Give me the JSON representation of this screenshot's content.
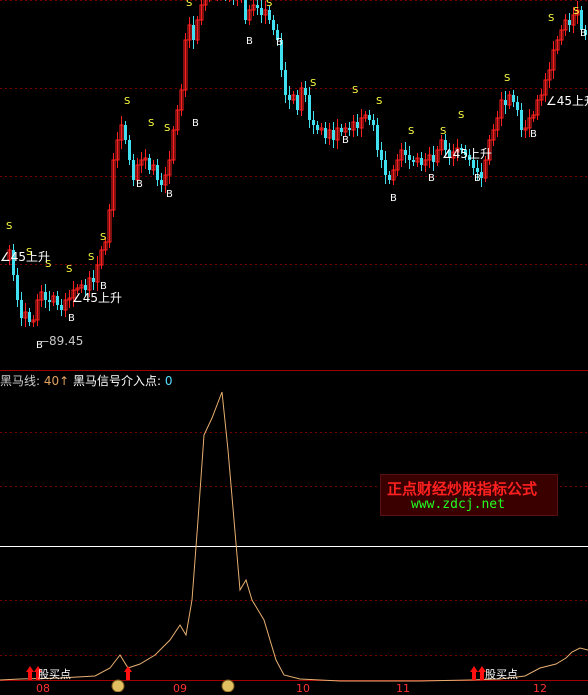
{
  "price_panel": {
    "low_label": "89.45",
    "sell_mark": "S",
    "buy_mark": "B",
    "slope_tag": "∠45上升",
    "slope_tag_cut": "∠45上升"
  },
  "indicator": {
    "name": "黑马线:",
    "value": "40↑",
    "signal_name": "黑马信号介入点:",
    "signal_value": "0",
    "buy_label": "股买点"
  },
  "watermark": {
    "title": "正点财经炒股指标公式",
    "url": "www.zdcj.net"
  },
  "months": [
    "08",
    "09",
    "10",
    "11",
    "12"
  ],
  "colors": {
    "up": "#ff2020",
    "down": "#40e0f0",
    "sell_marker": "#ffff40",
    "buy_marker": "#ffffff",
    "indicator_line": "#e8b070",
    "grid": "#7a0000"
  }
}
